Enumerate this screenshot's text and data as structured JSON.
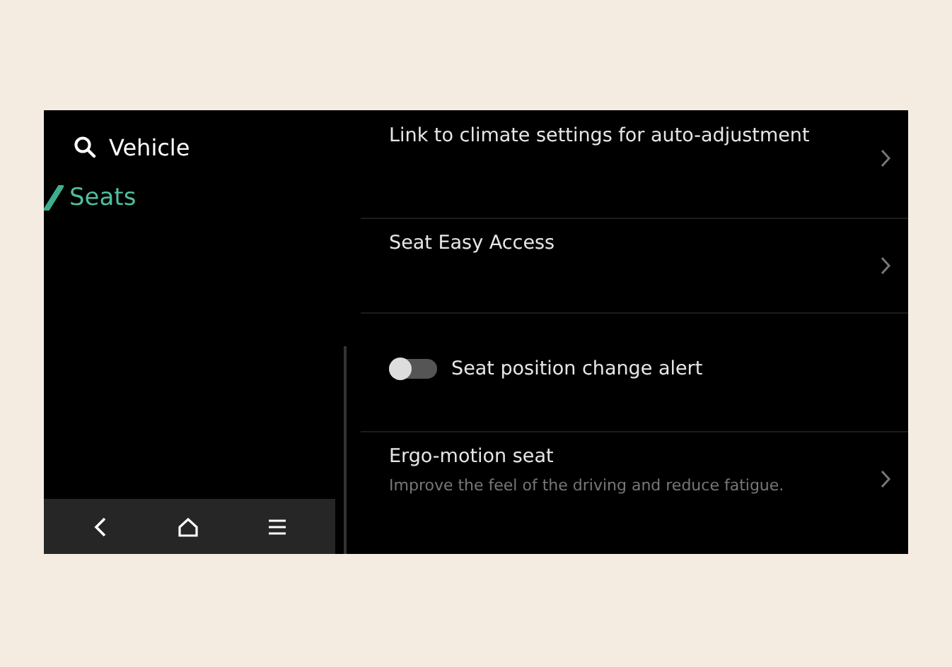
{
  "header": {
    "title": "Vehicle"
  },
  "sidebar": {
    "items": [
      {
        "label": "Seats",
        "selected": true
      }
    ]
  },
  "settings": [
    {
      "kind": "link",
      "title": "Link to climate settings for auto-adjustment"
    },
    {
      "kind": "link",
      "title": "Seat Easy Access"
    },
    {
      "kind": "toggle",
      "title": "Seat position change alert",
      "on": false
    },
    {
      "kind": "link",
      "title": "Ergo-motion seat",
      "subtitle": "Improve the feel of the driving and reduce fatigue."
    }
  ]
}
